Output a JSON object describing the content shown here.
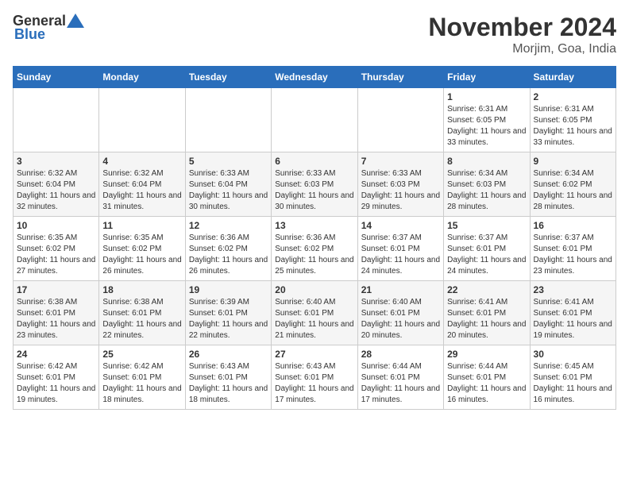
{
  "header": {
    "logo": {
      "text_general": "General",
      "text_blue": "Blue"
    },
    "month": "November 2024",
    "location": "Morjim, Goa, India"
  },
  "weekdays": [
    "Sunday",
    "Monday",
    "Tuesday",
    "Wednesday",
    "Thursday",
    "Friday",
    "Saturday"
  ],
  "weeks": [
    [
      {
        "day": "",
        "info": ""
      },
      {
        "day": "",
        "info": ""
      },
      {
        "day": "",
        "info": ""
      },
      {
        "day": "",
        "info": ""
      },
      {
        "day": "",
        "info": ""
      },
      {
        "day": "1",
        "info": "Sunrise: 6:31 AM\nSunset: 6:05 PM\nDaylight: 11 hours and 33 minutes."
      },
      {
        "day": "2",
        "info": "Sunrise: 6:31 AM\nSunset: 6:05 PM\nDaylight: 11 hours and 33 minutes."
      }
    ],
    [
      {
        "day": "3",
        "info": "Sunrise: 6:32 AM\nSunset: 6:04 PM\nDaylight: 11 hours and 32 minutes."
      },
      {
        "day": "4",
        "info": "Sunrise: 6:32 AM\nSunset: 6:04 PM\nDaylight: 11 hours and 31 minutes."
      },
      {
        "day": "5",
        "info": "Sunrise: 6:33 AM\nSunset: 6:04 PM\nDaylight: 11 hours and 30 minutes."
      },
      {
        "day": "6",
        "info": "Sunrise: 6:33 AM\nSunset: 6:03 PM\nDaylight: 11 hours and 30 minutes."
      },
      {
        "day": "7",
        "info": "Sunrise: 6:33 AM\nSunset: 6:03 PM\nDaylight: 11 hours and 29 minutes."
      },
      {
        "day": "8",
        "info": "Sunrise: 6:34 AM\nSunset: 6:03 PM\nDaylight: 11 hours and 28 minutes."
      },
      {
        "day": "9",
        "info": "Sunrise: 6:34 AM\nSunset: 6:02 PM\nDaylight: 11 hours and 28 minutes."
      }
    ],
    [
      {
        "day": "10",
        "info": "Sunrise: 6:35 AM\nSunset: 6:02 PM\nDaylight: 11 hours and 27 minutes."
      },
      {
        "day": "11",
        "info": "Sunrise: 6:35 AM\nSunset: 6:02 PM\nDaylight: 11 hours and 26 minutes."
      },
      {
        "day": "12",
        "info": "Sunrise: 6:36 AM\nSunset: 6:02 PM\nDaylight: 11 hours and 26 minutes."
      },
      {
        "day": "13",
        "info": "Sunrise: 6:36 AM\nSunset: 6:02 PM\nDaylight: 11 hours and 25 minutes."
      },
      {
        "day": "14",
        "info": "Sunrise: 6:37 AM\nSunset: 6:01 PM\nDaylight: 11 hours and 24 minutes."
      },
      {
        "day": "15",
        "info": "Sunrise: 6:37 AM\nSunset: 6:01 PM\nDaylight: 11 hours and 24 minutes."
      },
      {
        "day": "16",
        "info": "Sunrise: 6:37 AM\nSunset: 6:01 PM\nDaylight: 11 hours and 23 minutes."
      }
    ],
    [
      {
        "day": "17",
        "info": "Sunrise: 6:38 AM\nSunset: 6:01 PM\nDaylight: 11 hours and 23 minutes."
      },
      {
        "day": "18",
        "info": "Sunrise: 6:38 AM\nSunset: 6:01 PM\nDaylight: 11 hours and 22 minutes."
      },
      {
        "day": "19",
        "info": "Sunrise: 6:39 AM\nSunset: 6:01 PM\nDaylight: 11 hours and 22 minutes."
      },
      {
        "day": "20",
        "info": "Sunrise: 6:40 AM\nSunset: 6:01 PM\nDaylight: 11 hours and 21 minutes."
      },
      {
        "day": "21",
        "info": "Sunrise: 6:40 AM\nSunset: 6:01 PM\nDaylight: 11 hours and 20 minutes."
      },
      {
        "day": "22",
        "info": "Sunrise: 6:41 AM\nSunset: 6:01 PM\nDaylight: 11 hours and 20 minutes."
      },
      {
        "day": "23",
        "info": "Sunrise: 6:41 AM\nSunset: 6:01 PM\nDaylight: 11 hours and 19 minutes."
      }
    ],
    [
      {
        "day": "24",
        "info": "Sunrise: 6:42 AM\nSunset: 6:01 PM\nDaylight: 11 hours and 19 minutes."
      },
      {
        "day": "25",
        "info": "Sunrise: 6:42 AM\nSunset: 6:01 PM\nDaylight: 11 hours and 18 minutes."
      },
      {
        "day": "26",
        "info": "Sunrise: 6:43 AM\nSunset: 6:01 PM\nDaylight: 11 hours and 18 minutes."
      },
      {
        "day": "27",
        "info": "Sunrise: 6:43 AM\nSunset: 6:01 PM\nDaylight: 11 hours and 17 minutes."
      },
      {
        "day": "28",
        "info": "Sunrise: 6:44 AM\nSunset: 6:01 PM\nDaylight: 11 hours and 17 minutes."
      },
      {
        "day": "29",
        "info": "Sunrise: 6:44 AM\nSunset: 6:01 PM\nDaylight: 11 hours and 16 minutes."
      },
      {
        "day": "30",
        "info": "Sunrise: 6:45 AM\nSunset: 6:01 PM\nDaylight: 11 hours and 16 minutes."
      }
    ]
  ]
}
